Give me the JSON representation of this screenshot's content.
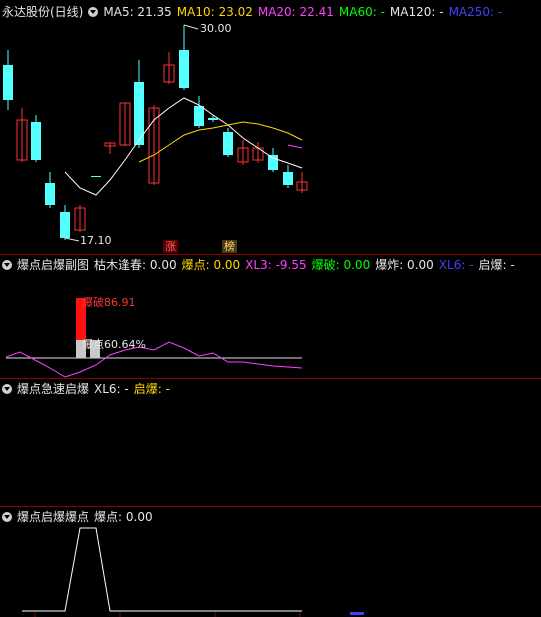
{
  "main_panel": {
    "title": "永达股份(日线)",
    "ma5": "MA5: 21.35",
    "ma10": "MA10: 23.02",
    "ma20": "MA20: 22.41",
    "ma60": "MA60: -",
    "ma120": "MA120: -",
    "ma250": "MA250: -",
    "high_label": "30.00",
    "low_label": "17.10",
    "tag_zhang": "涨",
    "tag_bang": "榜"
  },
  "panel2": {
    "title": "爆点启爆副图",
    "kmfc": "枯木逢春: 0.00",
    "bd": "爆点: 0.00",
    "xl3": "XL3: -9.55",
    "bp": "爆破: 0.00",
    "bz": "爆炸: 0.00",
    "xl6": "XL6: -",
    "qb": "启爆: -",
    "label_bp": "爆破86.91",
    "label_bd": "爆点60.64%"
  },
  "panel3": {
    "title": "爆点急速启爆",
    "xl6": "XL6: -",
    "qb": "启爆: -"
  },
  "panel4": {
    "title": "爆点启爆爆点",
    "bd": "爆点: 0.00"
  },
  "colors": {
    "up": "#ff3232",
    "down": "#54ffff",
    "ma5": "#ffffff",
    "ma10": "#ffd700",
    "ma20": "#ff40ff"
  }
}
